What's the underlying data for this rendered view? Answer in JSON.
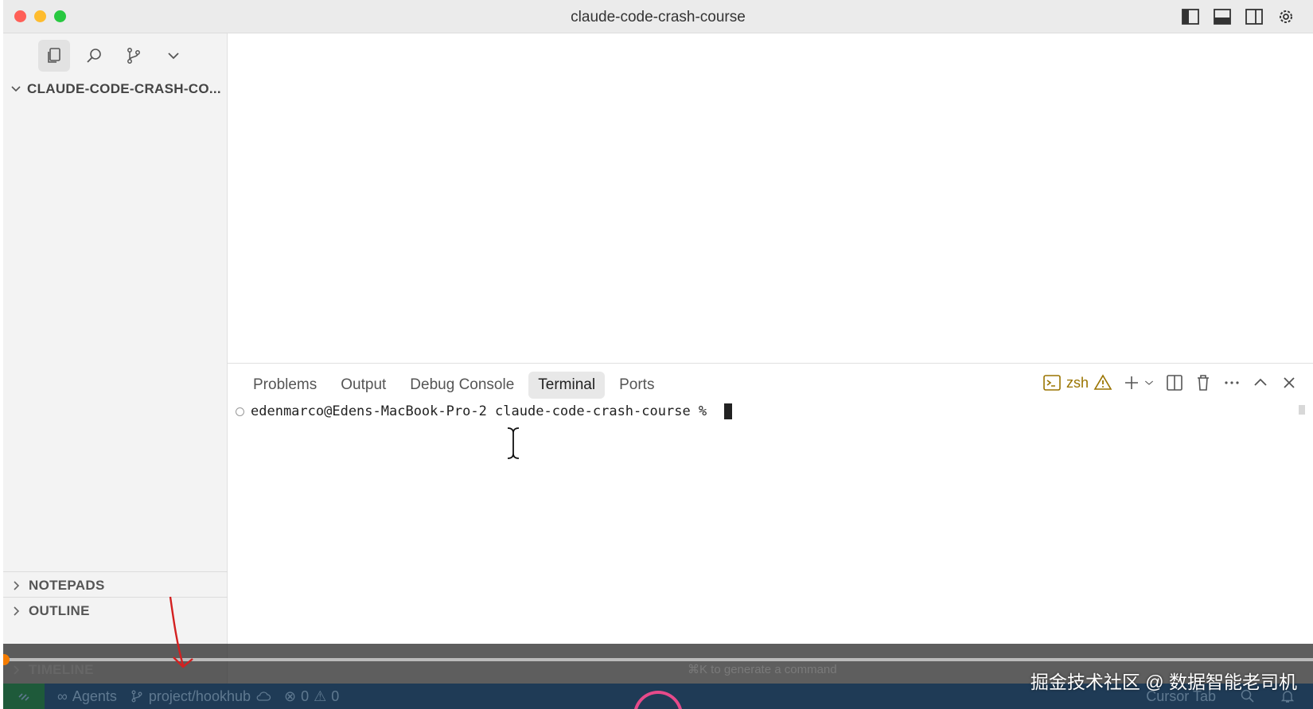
{
  "window": {
    "title": "claude-code-crash-course"
  },
  "sidebar": {
    "explorer_title": "CLAUDE-CODE-CRASH-CO...",
    "sections": {
      "notepads": "NOTEPADS",
      "outline": "OUTLINE",
      "timeline": "TIMELINE"
    }
  },
  "panel": {
    "tabs": [
      "Problems",
      "Output",
      "Debug Console",
      "Terminal",
      "Ports"
    ],
    "active_tab": "Terminal",
    "shell": "zsh",
    "terminal_prompt": "edenmarco@Edens-MacBook-Pro-2 claude-code-crash-course % "
  },
  "hint": "⌘K to generate a command",
  "statusbar": {
    "agents": "Agents",
    "branch": "project/hookhub",
    "errors": "0",
    "warnings": "0",
    "right_label": "Cursor Tab"
  },
  "watermark": "掘金技术社区 @ 数据智能老司机",
  "colors": {
    "accent_status": "#1f3b56",
    "arrow": "#d32020",
    "progress_dot": "#f57c00"
  }
}
